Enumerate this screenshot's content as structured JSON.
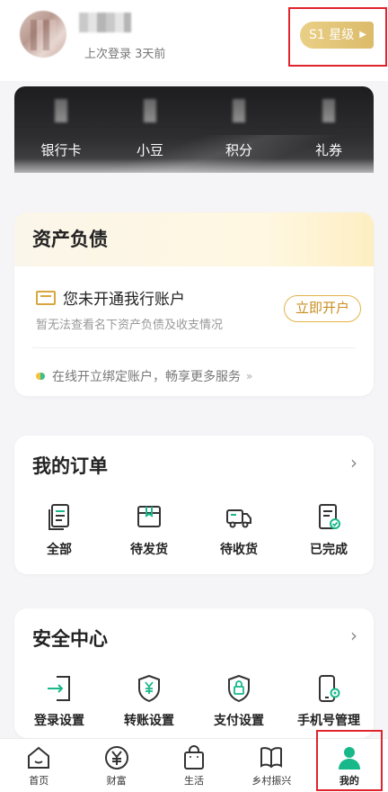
{
  "profile": {
    "last_login": "上次登录 3天前",
    "level_badge": "S1 星级"
  },
  "assets": {
    "items": [
      {
        "label": "银行卡"
      },
      {
        "label": "小豆"
      },
      {
        "label": "积分"
      },
      {
        "label": "礼券"
      }
    ]
  },
  "liabilities": {
    "title": "资产负债",
    "row_title": "您未开通我行账户",
    "row_subtitle": "暂无法查看名下资产负债及收支情况",
    "open_button": "立即开户",
    "promo": "在线开立绑定账户，畅享更多服务",
    "promo_chevron": "»"
  },
  "orders": {
    "title": "我的订单",
    "items": [
      {
        "label": "全部",
        "icon": "document-list-icon"
      },
      {
        "label": "待发货",
        "icon": "package-icon"
      },
      {
        "label": "待收货",
        "icon": "truck-icon"
      },
      {
        "label": "已完成",
        "icon": "document-check-icon"
      }
    ]
  },
  "security": {
    "title": "安全中心",
    "items": [
      {
        "label": "登录设置",
        "icon": "login-icon"
      },
      {
        "label": "转账设置",
        "icon": "shield-yen-icon"
      },
      {
        "label": "支付设置",
        "icon": "shield-lock-icon"
      },
      {
        "label": "手机号管理",
        "icon": "phone-gear-icon"
      }
    ]
  },
  "tabbar": {
    "items": [
      {
        "label": "首页",
        "icon": "home-icon"
      },
      {
        "label": "财富",
        "icon": "yen-circle-icon"
      },
      {
        "label": "生活",
        "icon": "shopping-bag-icon"
      },
      {
        "label": "乡村振兴",
        "icon": "leaf-book-icon"
      },
      {
        "label": "我的",
        "icon": "person-icon",
        "active": true
      }
    ]
  },
  "colors": {
    "accent_gold": "#dcbb6a",
    "accent_green": "#19b88a",
    "highlight_red": "#e0242d"
  }
}
